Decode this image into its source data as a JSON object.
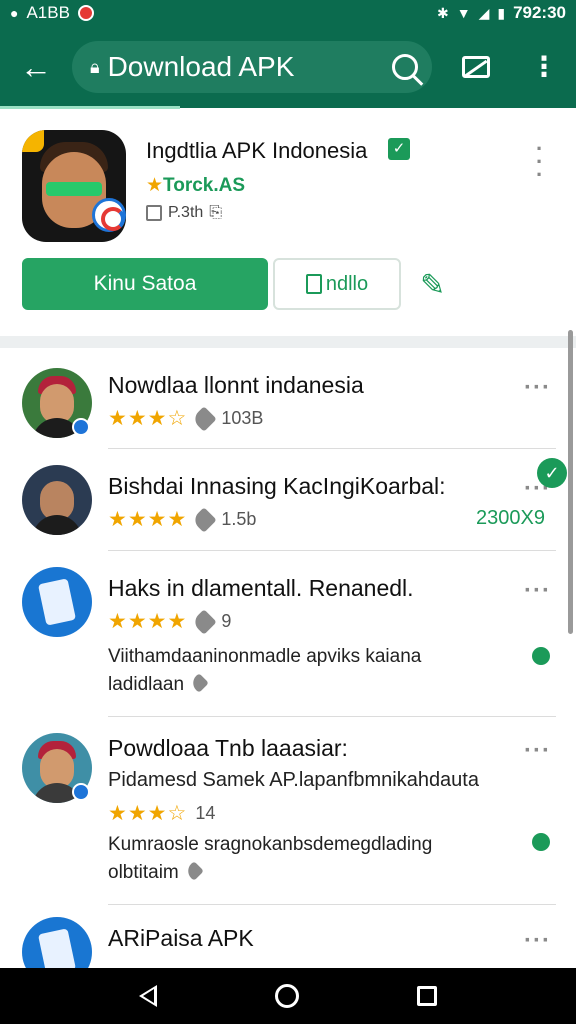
{
  "status_bar": {
    "left_text": "A1BB",
    "time": "792:30"
  },
  "browser": {
    "url_text": "Download APK"
  },
  "app": {
    "title": "Ingdtlia APK Indonesia",
    "developer": "Torck.AS",
    "meta": "P.3th",
    "primary_button": "Kinu Satoa",
    "secondary_button": "ndllo"
  },
  "list": [
    {
      "title": "Nowdlaa llonnt indanesia",
      "stars": "★★★☆",
      "rating": "103B"
    },
    {
      "title": "Bishdai Innasing KacIngiKoarbal:",
      "stars": "★★★★",
      "rating": "1.5b",
      "downloads": "2300X9"
    },
    {
      "title": "Haks in dlamentall. Renanedl.",
      "stars": "★★★★",
      "rating": "9",
      "desc_line1": "Viithamdaaninonmadle apviks kaiana",
      "desc_line2": "ladidlaan"
    },
    {
      "title": "Powdloaa Tnb laaasiar:",
      "subtitle": "Pidamesd Samek AP.lapanfbmnikahdauta",
      "stars": "★★★☆",
      "rating": "14",
      "desc_line1": "Kumraosle sragnokanbsdemegdlading",
      "desc_line2": "olbtitaim"
    },
    {
      "title": "ARiPaisa APK"
    }
  ],
  "icons": {
    "accent": "#0b6b4e",
    "green": "#1b9a59",
    "star": "#f0a500"
  }
}
